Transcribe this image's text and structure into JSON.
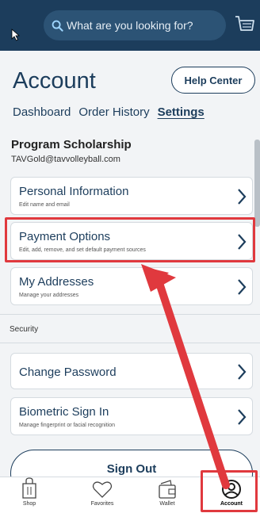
{
  "header": {
    "search_placeholder": "What are you looking for?"
  },
  "page": {
    "title": "Account",
    "help_label": "Help Center"
  },
  "tabs": [
    {
      "label": "Dashboard",
      "active": false
    },
    {
      "label": "Order History",
      "active": false
    },
    {
      "label": "Settings",
      "active": true
    }
  ],
  "user": {
    "name": "Program Scholarship",
    "email": "TAVGold@tavvolleyball.com"
  },
  "settings": [
    {
      "title": "Personal Information",
      "subtitle": "Edit name and email"
    },
    {
      "title": "Payment Options",
      "subtitle": "Edit, add, remove, and set default payment sources"
    },
    {
      "title": "My Addresses",
      "subtitle": "Manage your addresses"
    }
  ],
  "security": {
    "label": "Security",
    "items": [
      {
        "title": "Change Password",
        "subtitle": ""
      },
      {
        "title": "Biometric Sign In",
        "subtitle": "Manage fingerprint or facial recognition"
      }
    ]
  },
  "signout_label": "Sign Out",
  "bottom_nav": [
    {
      "label": "Shop",
      "active": false
    },
    {
      "label": "Favorites",
      "active": false
    },
    {
      "label": "Wallet",
      "active": false
    },
    {
      "label": "Account",
      "active": true
    }
  ],
  "colors": {
    "primary": "#1c3d5c",
    "annotation": "#e0393e",
    "background": "#f2f4f6"
  }
}
